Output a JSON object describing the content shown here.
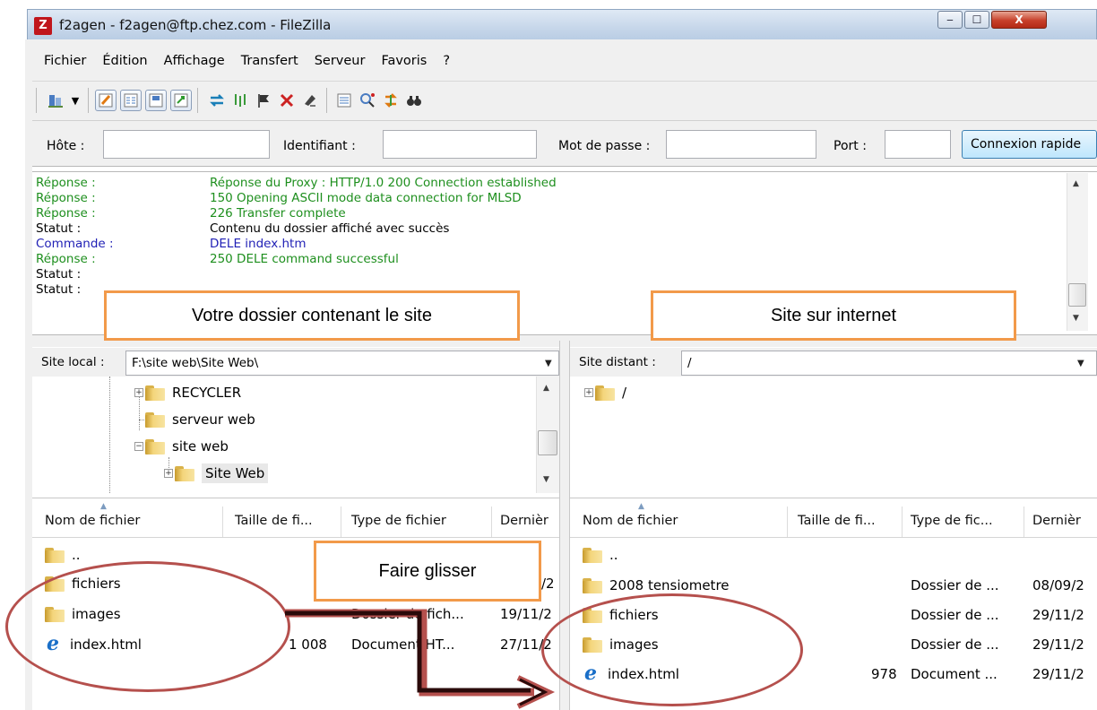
{
  "window": {
    "title": "f2agen - f2agen@ftp.chez.com - FileZilla",
    "app_icon": "Z",
    "controls": {
      "minimize": "‒",
      "maximize": "☐",
      "close": "X"
    }
  },
  "menu": [
    "Fichier",
    "Édition",
    "Affichage",
    "Transfert",
    "Serveur",
    "Favoris",
    "?"
  ],
  "toolbar": {
    "icons": [
      "site-manager-icon",
      "dropdown-arrow-icon",
      "toggle-log-icon",
      "toggle-tree-icon",
      "toggle-remote-tree-icon",
      "toggle-queue-icon",
      "refresh-icon",
      "process-queue-icon",
      "cancel-icon",
      "disconnect-icon",
      "reconnect-icon",
      "directory-listing-filter-icon",
      "compare-icon",
      "sync-browse-icon",
      "search-icon"
    ]
  },
  "quickconnect": {
    "host_label": "Hôte :",
    "user_label": "Identifiant :",
    "pass_label": "Mot de passe :",
    "port_label": "Port :",
    "host_value": "",
    "user_value": "",
    "pass_value": "",
    "port_value": "",
    "connect_label": "Connexion rapide"
  },
  "log": [
    {
      "type": "resp",
      "label": "Réponse :",
      "msg": "Réponse du Proxy : HTTP/1.0 200 Connection established"
    },
    {
      "type": "resp",
      "label": "Réponse :",
      "msg": "150 Opening ASCII mode data connection for MLSD"
    },
    {
      "type": "resp",
      "label": "Réponse :",
      "msg": "226 Transfer complete"
    },
    {
      "type": "stat",
      "label": "Statut :",
      "msg": "Contenu du dossier affiché avec succès"
    },
    {
      "type": "cmd",
      "label": "Commande :",
      "msg": "DELE index.htm"
    },
    {
      "type": "resp",
      "label": "Réponse :",
      "msg": "250 DELE command successful"
    },
    {
      "type": "stat",
      "label": "Statut :",
      "msg": ""
    },
    {
      "type": "stat",
      "label": "Statut :",
      "msg": ""
    }
  ],
  "local": {
    "label": "Site local :",
    "path": "F:\\site web\\Site Web\\",
    "tree": [
      "RECYCLER",
      "serveur web",
      "site web",
      "Site Web"
    ],
    "columns": [
      "Nom de fichier",
      "Taille de fi...",
      "Type de fichier",
      "Dernièr"
    ],
    "files": [
      {
        "name": "..",
        "size": "",
        "type": "",
        "date": ""
      },
      {
        "name": "fichiers",
        "size": "",
        "type": "",
        "date": "/2"
      },
      {
        "name": "images",
        "size": "",
        "type": "Dossier de fich...",
        "date": "19/11/2"
      },
      {
        "name": "index.html",
        "size": "1 008",
        "type": "Document HT...",
        "date": "27/11/2"
      }
    ]
  },
  "remote": {
    "label": "Site distant :",
    "path": "/",
    "tree": [
      "/"
    ],
    "columns": [
      "Nom de fichier",
      "Taille de fi...",
      "Type de fic...",
      "Dernièr"
    ],
    "files": [
      {
        "name": "..",
        "size": "",
        "type": "",
        "date": ""
      },
      {
        "name": "2008 tensiometre",
        "size": "",
        "type": "Dossier de ...",
        "date": "08/09/2"
      },
      {
        "name": "fichiers",
        "size": "",
        "type": "Dossier de ...",
        "date": "29/11/2"
      },
      {
        "name": "images",
        "size": "",
        "type": "Dossier de ...",
        "date": "29/11/2"
      },
      {
        "name": "index.html",
        "size": "978",
        "type": "Document ...",
        "date": "29/11/2"
      }
    ]
  },
  "annotations": {
    "local_callout": "Votre dossier contenant le site",
    "remote_callout": "Site sur internet",
    "drag_callout": "Faire glisser"
  },
  "colors": {
    "response": "#1e8f1e",
    "command": "#1f1fb5",
    "callout_border": "#f29a4a",
    "ellipse": "#b5504d",
    "arrow": "#2a0a0a"
  }
}
